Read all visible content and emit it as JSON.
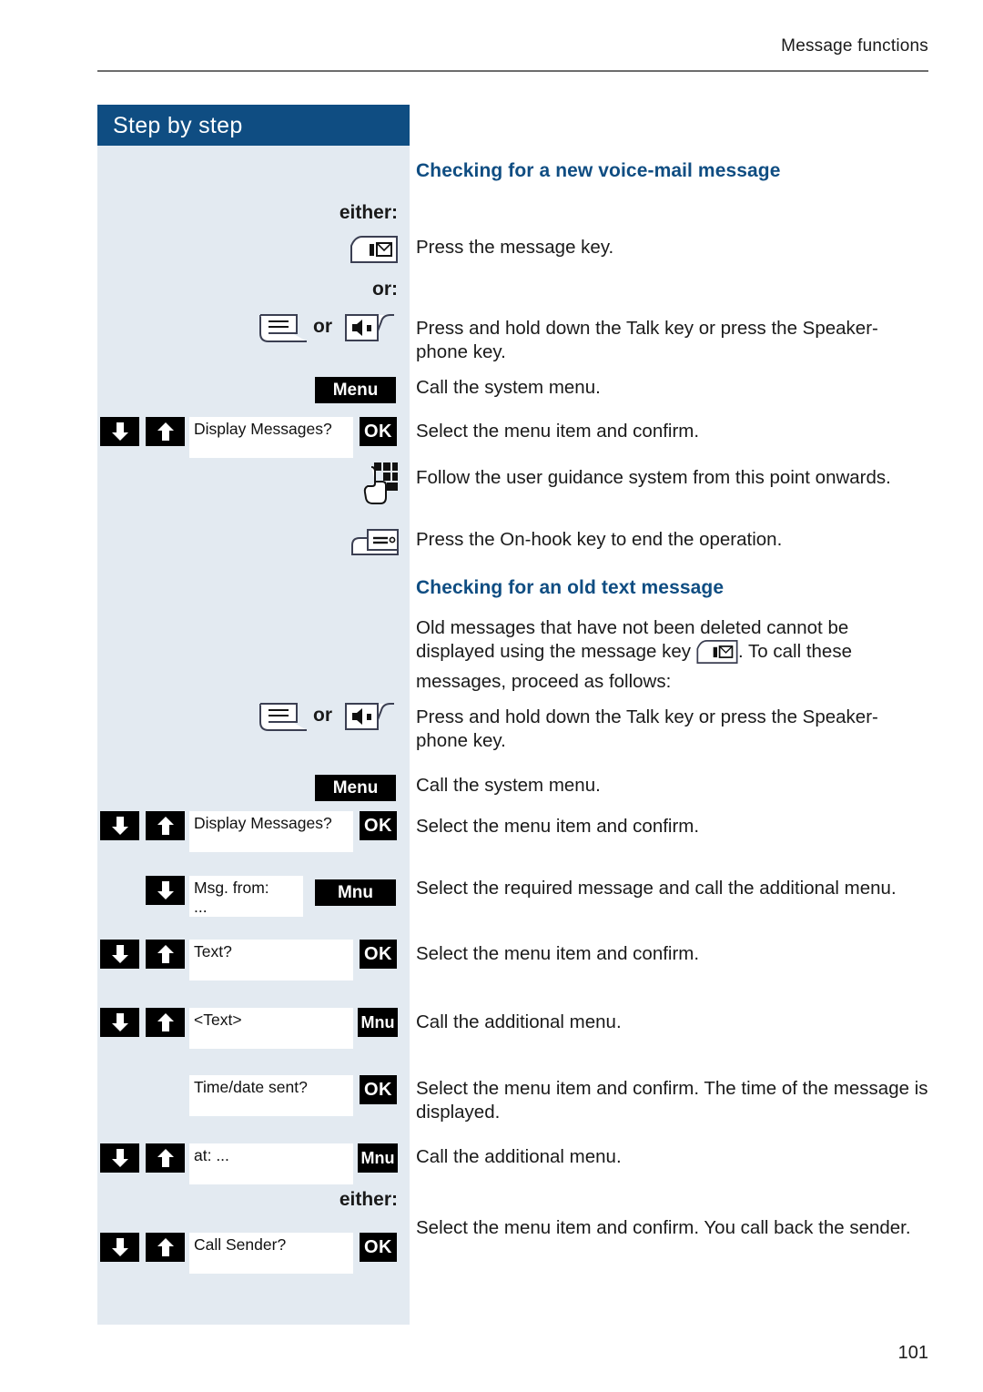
{
  "header": {
    "running_title": "Message functions"
  },
  "sidebar": {
    "title": "Step by step"
  },
  "footer": {
    "page_number": "101"
  },
  "labels": {
    "either": "either:",
    "or": "or:",
    "or_inline": "or"
  },
  "keys": {
    "ok": "OK",
    "mnu": "Mnu",
    "menu": "Menu"
  },
  "sections": [
    {
      "heading": "Checking for a new voice-mail message"
    },
    {
      "heading": "Checking for an old text message",
      "intro_part1": "Old messages that have not been deleted cannot be displayed using the message key",
      "intro_part2": ". To call these messages, proceed as follows:"
    }
  ],
  "steps": {
    "message_key": "Press the message key.",
    "talk_speaker": "Press and hold down the Talk key or press the Speaker-phone key.",
    "call_system_menu": "Call the system menu.",
    "select_confirm": "Select the menu item and confirm.",
    "user_guidance": "Follow the user guidance system from this point onwards.",
    "on_hook": "Press the On-hook key to end the operation.",
    "select_message_call_additional": "Select the required message and call the additional menu.",
    "call_additional_menu": "Call the additional menu.",
    "select_confirm_time": "Select the menu item and confirm. The time of the message is displayed.",
    "select_confirm_callback": "Select the menu item and confirm. You call back the sender."
  },
  "display_values": {
    "display_messages_1": "Display Messages?",
    "display_messages_2": "Display Messages?",
    "msg_from_line1": "Msg. from:",
    "msg_from_line2": "...",
    "text_q": "Text?",
    "text_placeholder": "<Text>",
    "time_date_sent": "Time/date sent?",
    "at_value": "at: ...",
    "call_sender": "Call Sender?"
  },
  "colors": {
    "brand_blue": "#0f4d82",
    "sidebar_bg": "#e3eaf1",
    "key_black": "#000000",
    "rule_gray": "#6d6d6d"
  },
  "icons": {
    "message_key": "message-key-icon",
    "talk_key": "talk-key-icon",
    "speakerphone_key": "speakerphone-key-icon",
    "keypad": "keypad-hand-icon",
    "on_hook_key": "on-hook-key-icon",
    "arrow_down": "arrow-down-icon",
    "arrow_up": "arrow-up-icon"
  }
}
